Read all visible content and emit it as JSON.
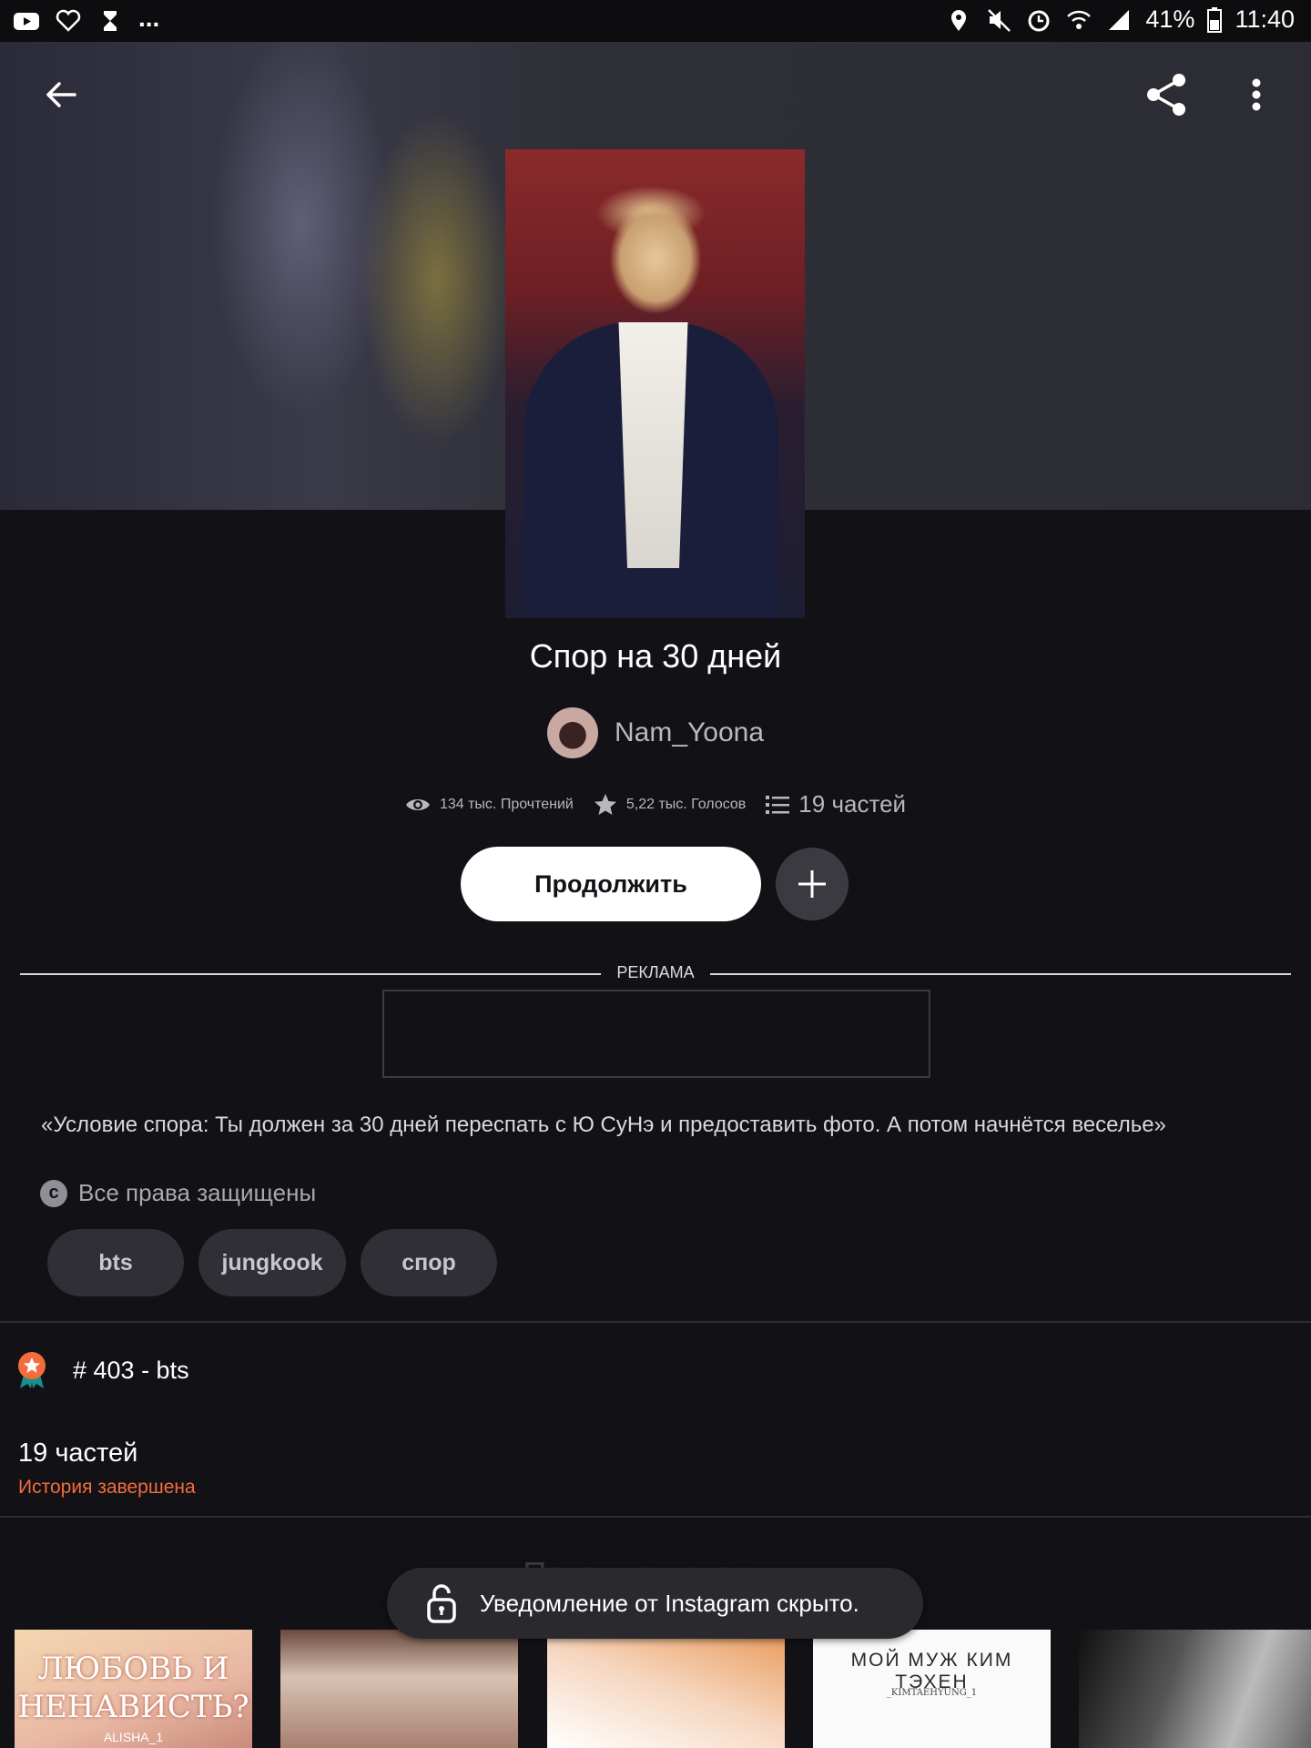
{
  "status_bar": {
    "left_icons": [
      "youtube-icon",
      "heart-icon",
      "hourglass-icon",
      "more-dots-icon"
    ],
    "more_text": "...",
    "battery_percent": "41%",
    "time": "11:40"
  },
  "book": {
    "title": "Спор на 30 дней",
    "author": "Nam_Yoona",
    "reads": "134 тыс. Прочтений",
    "votes": "5,22 тыс. Голосов",
    "parts": "19 частей"
  },
  "actions": {
    "continue_label": "Продолжить"
  },
  "ad": {
    "label": "РЕКЛАМА"
  },
  "description": "«Условие спора: Ты должен за 30 дней переспать с Ю СуНэ и предоставить фото. А потом начнётся веселье»",
  "copyright": "Все права защищены",
  "tags": [
    "bts",
    "jungkook",
    "спор"
  ],
  "rank": "# 403 - bts",
  "parts_section": {
    "title": "19 частей",
    "status": "История завершена"
  },
  "similar": {
    "title": "Похожие истории",
    "covers": [
      {
        "text": "ЛЮБОВЬ И НЕНАВИСТЬ?",
        "sub": "ALISHA_1"
      },
      {
        "text": "",
        "sub": ""
      },
      {
        "text": "",
        "sub": ""
      },
      {
        "text": "МОЙ МУЖ КИМ ТЭХЕН",
        "sub": "_KIMTAEHYUNG_1"
      },
      {
        "text": "",
        "sub": ""
      }
    ]
  },
  "toast": {
    "text": "Уведомление от Instagram скрыто."
  }
}
